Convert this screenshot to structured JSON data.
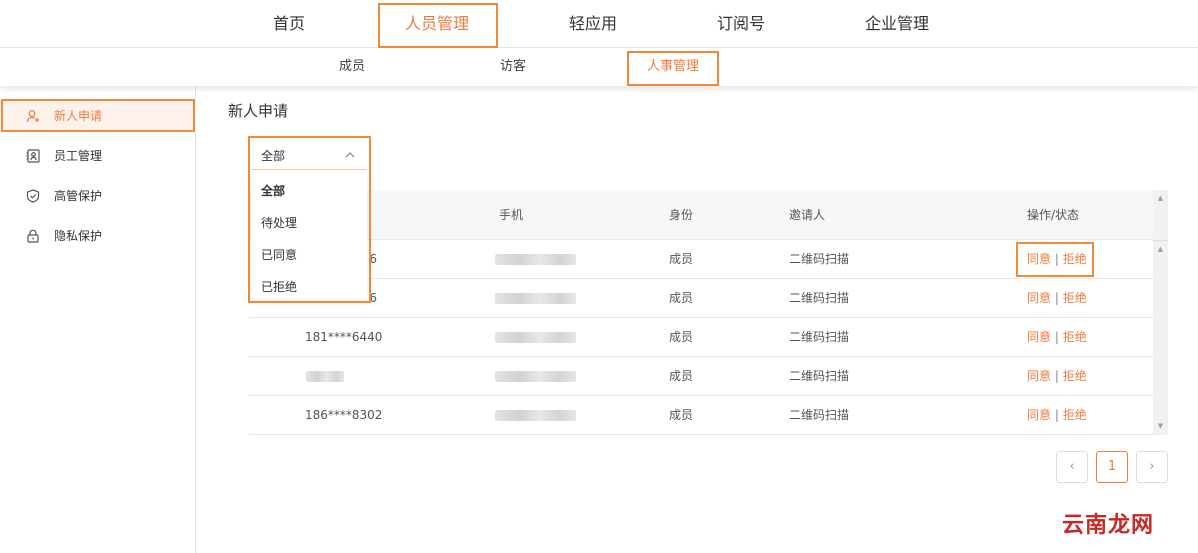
{
  "top_nav": {
    "items": [
      {
        "label": "首页"
      },
      {
        "label": "人员管理",
        "active": true
      },
      {
        "label": "轻应用"
      },
      {
        "label": "订阅号"
      },
      {
        "label": "企业管理"
      }
    ]
  },
  "sub_nav": {
    "items": [
      {
        "label": "成员"
      },
      {
        "label": "访客"
      },
      {
        "label": "人事管理",
        "active": true
      }
    ]
  },
  "sidebar": {
    "items": [
      {
        "label": "新人申请",
        "icon": "user-add-icon",
        "active": true
      },
      {
        "label": "员工管理",
        "icon": "id-card-icon"
      },
      {
        "label": "高管保护",
        "icon": "shield-icon"
      },
      {
        "label": "隐私保护",
        "icon": "lock-icon"
      }
    ]
  },
  "page": {
    "title": "新人申请"
  },
  "filter": {
    "selected": "全部",
    "options": [
      "全部",
      "待处理",
      "已同意",
      "已拒绝"
    ]
  },
  "table": {
    "columns": [
      "手机",
      "身份",
      "邀请人",
      "操作/状态"
    ],
    "rows": [
      {
        "name": "6",
        "identity": "成员",
        "inviter": "二维码扫描",
        "agree": "同意",
        "sep": "|",
        "reject": "拒绝"
      },
      {
        "name": "6",
        "identity": "成员",
        "inviter": "二维码扫描",
        "agree": "同意",
        "sep": "|",
        "reject": "拒绝"
      },
      {
        "name": "181****6440",
        "identity": "成员",
        "inviter": "二维码扫描",
        "agree": "同意",
        "sep": "|",
        "reject": "拒绝"
      },
      {
        "name": "",
        "identity": "成员",
        "inviter": "二维码扫描",
        "agree": "同意",
        "sep": "|",
        "reject": "拒绝"
      },
      {
        "name": "186****8302",
        "identity": "成员",
        "inviter": "二维码扫描",
        "agree": "同意",
        "sep": "|",
        "reject": "拒绝"
      }
    ]
  },
  "pagination": {
    "prev": "‹",
    "current": "1",
    "next": "›"
  },
  "watermark": "云南龙网",
  "colors": {
    "accent": "#f07b3f",
    "highlight_box": "#ee8a3c"
  }
}
